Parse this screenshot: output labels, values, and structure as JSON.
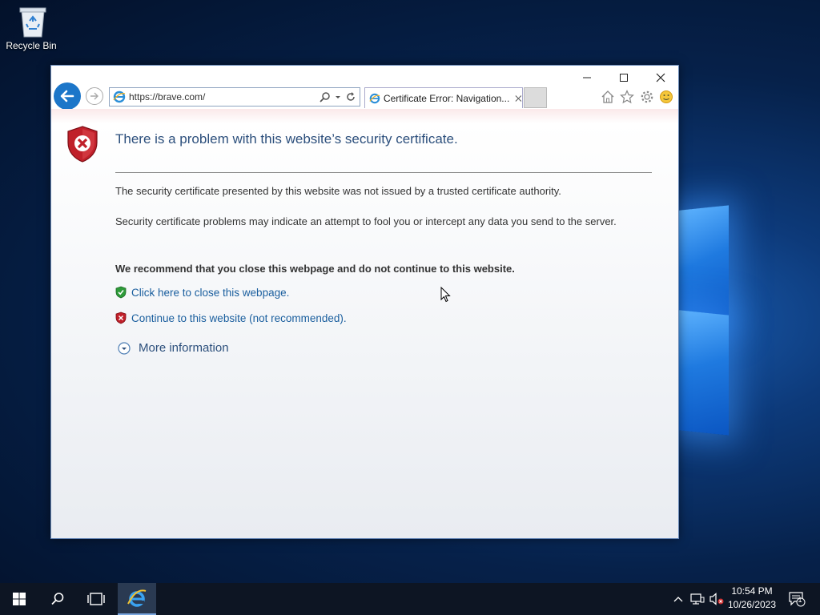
{
  "desktop": {
    "recycle_bin_label": "Recycle Bin"
  },
  "browser": {
    "address": "https://brave.com/",
    "tab_title": "Certificate Error: Navigation...",
    "colors": {
      "accent": "#1c76c9",
      "link": "#1a5e9e",
      "heading": "#2c4f7c"
    }
  },
  "page": {
    "heading": "There is a problem with this website’s security certificate.",
    "para1": "The security certificate presented by this website was not issued by a trusted certificate authority.",
    "para2": "Security certificate problems may indicate an attempt to fool you or intercept any data you send to the server.",
    "recommend": "We recommend that you close this webpage and do not continue to this website.",
    "close_link": "Click here to close this webpage.",
    "continue_link": "Continue to this website (not recommended).",
    "more_info": "More information"
  },
  "taskbar": {
    "time": "10:54 PM",
    "date": "10/26/2023",
    "notification_count": "1"
  }
}
